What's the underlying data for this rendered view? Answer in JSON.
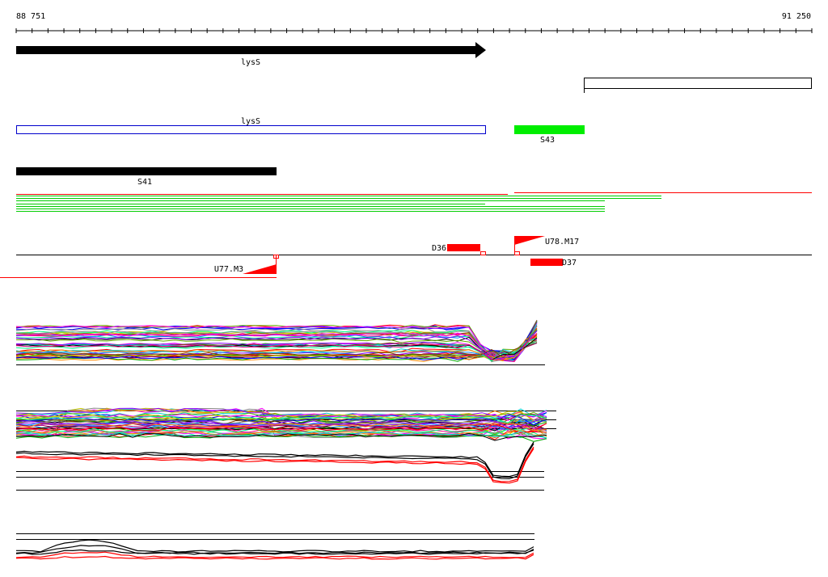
{
  "ruler": {
    "start_label": "88 751",
    "end_label": "91 250"
  },
  "genes": [
    {
      "name": "lysS",
      "style": "black-arrow"
    },
    {
      "name": "lysS",
      "style": "blue-outline"
    }
  ],
  "segments": [
    {
      "name": "S43",
      "color": "#00ee00"
    },
    {
      "name": "S41",
      "color": "#000000"
    }
  ],
  "features": {
    "D36": "D36",
    "D37": "D37",
    "U78_M17": "U78.M17",
    "U77_M3": "U77.M3"
  },
  "colors": {
    "red": "#ff0000",
    "green": "#00cc00",
    "blue": "#0000cc",
    "black": "#000000",
    "bright_green": "#00ee00"
  }
}
